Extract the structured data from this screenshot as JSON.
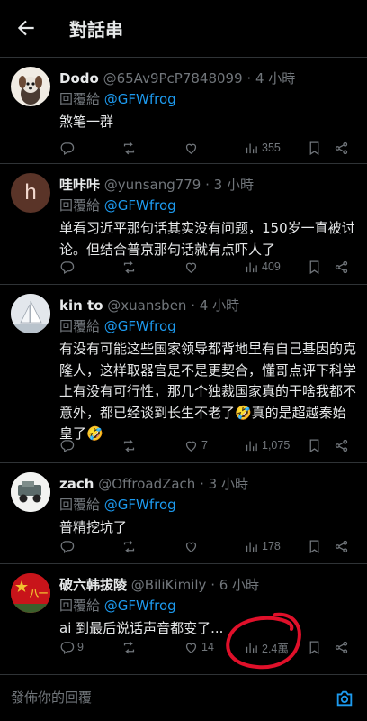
{
  "header": {
    "title": "對話串"
  },
  "tweets": [
    {
      "name": "Dodo",
      "handle": "@65Av9PcP7848099",
      "time": "· 4 小時",
      "reply_prefix": "回覆給",
      "reply_to": "@GFWfrog",
      "text": "煞笔一群",
      "replies": "",
      "retweets": "",
      "likes": "",
      "views": "355"
    },
    {
      "name": "哇咔咔",
      "handle": "@yunsang779",
      "time": "· 3 小時",
      "reply_prefix": "回覆給",
      "reply_to": "@GFWfrog",
      "text": "单看习近平那句话其实没有问题，150岁一直被讨论。但结合普京那句话就有点吓人了",
      "avatar_letter": "h",
      "replies": "",
      "retweets": "",
      "likes": "",
      "views": "409"
    },
    {
      "name": "kin to",
      "handle": "@xuansben",
      "time": "· 4 小時",
      "reply_prefix": "回覆給",
      "reply_to": "@GFWfrog",
      "text": "有没有可能这些国家领导都背地里有自己基因的克隆人，这样取器官是不是更契合，懂哥点评下科学上有没有可行性，那几个独裁国家真的干啥我都不意外，都已经谈到长生不老了🤣真的是超越秦始皇了🤣",
      "replies": "",
      "retweets": "",
      "likes": "7",
      "views": "1,075"
    },
    {
      "name": "zach",
      "handle": "@OffroadZach",
      "time": "· 3 小時",
      "reply_prefix": "回覆給",
      "reply_to": "@GFWfrog",
      "text": "普精挖坑了",
      "replies": "",
      "retweets": "",
      "likes": "",
      "views": "178"
    },
    {
      "name": "破六韩拔陵",
      "handle": "@BiliKimily",
      "time": "· 6 小時",
      "reply_prefix": "回覆給",
      "reply_to": "@GFWfrog",
      "text": "ai 到最后说话声音都变了...",
      "avatar_text": "八一",
      "replies": "9",
      "retweets": "",
      "likes": "14",
      "views": "2.4萬"
    }
  ],
  "composer": {
    "placeholder": "發佈你的回覆"
  },
  "colors": {
    "background": "#000000",
    "text": "#e7e9ea",
    "muted": "#71767b",
    "accent": "#1d9bf0",
    "annotation": "#e0102a"
  },
  "icons": [
    "back-arrow-icon",
    "reply-icon",
    "retweet-icon",
    "like-icon",
    "views-icon",
    "bookmark-icon",
    "share-icon",
    "camera-icon"
  ]
}
